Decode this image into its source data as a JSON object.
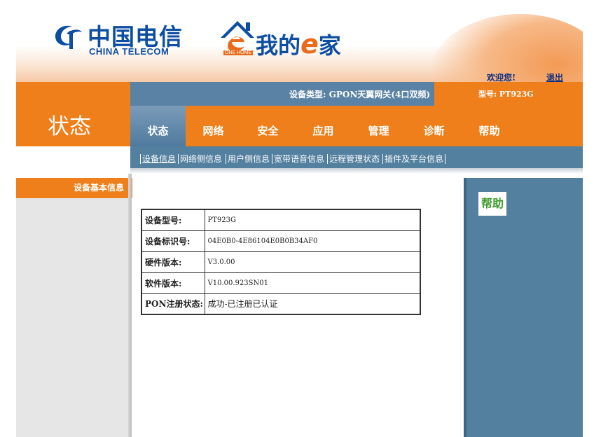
{
  "header": {
    "logo_cn": "中国电信",
    "logo_en": "CHINA TELECOM",
    "brand_prefix": "我的",
    "brand_e": "e",
    "brand_suffix": "家",
    "brand_badge": "ONE HOME",
    "welcome": "欢迎您!",
    "logout": "退出"
  },
  "infobar": {
    "device_type": "设备类型: GPON天翼网关(4口双频)",
    "model": "型号: PT923G"
  },
  "page_title": "状态",
  "nav": {
    "items": [
      {
        "label": "状态",
        "active": true
      },
      {
        "label": "网络",
        "active": false
      },
      {
        "label": "安全",
        "active": false
      },
      {
        "label": "应用",
        "active": false
      },
      {
        "label": "管理",
        "active": false
      },
      {
        "label": "诊断",
        "active": false
      },
      {
        "label": "帮助",
        "active": false
      }
    ]
  },
  "subnav": {
    "items": [
      {
        "label": "设备信息",
        "active": true
      },
      {
        "label": "网络侧信息",
        "active": false
      },
      {
        "label": "用户侧信息",
        "active": false
      },
      {
        "label": "宽带语音信息",
        "active": false
      },
      {
        "label": "远程管理状态",
        "active": false
      },
      {
        "label": "插件及平台信息",
        "active": false
      }
    ]
  },
  "sidebar": {
    "active_item": "设备基本信息"
  },
  "device_info": {
    "rows": [
      {
        "label": "设备型号:",
        "value": "PT923G"
      },
      {
        "label": "设备标识号:",
        "value": "04E0B0-4E86104E0B0B34AF0"
      },
      {
        "label": "硬件版本:",
        "value": "V3.0.00"
      },
      {
        "label": "软件版本:",
        "value": "V10.00.923SN01"
      },
      {
        "label": "PON注册状态:",
        "value": "成功-已注册已认证"
      }
    ]
  },
  "help": {
    "title": "帮助"
  },
  "colors": {
    "orange": "#ef7f1a",
    "steel_blue": "#54809f",
    "brand_blue": "#0d4ea2",
    "help_green": "#3c9a2a",
    "sidebar_grey": "#e6e6e6"
  }
}
